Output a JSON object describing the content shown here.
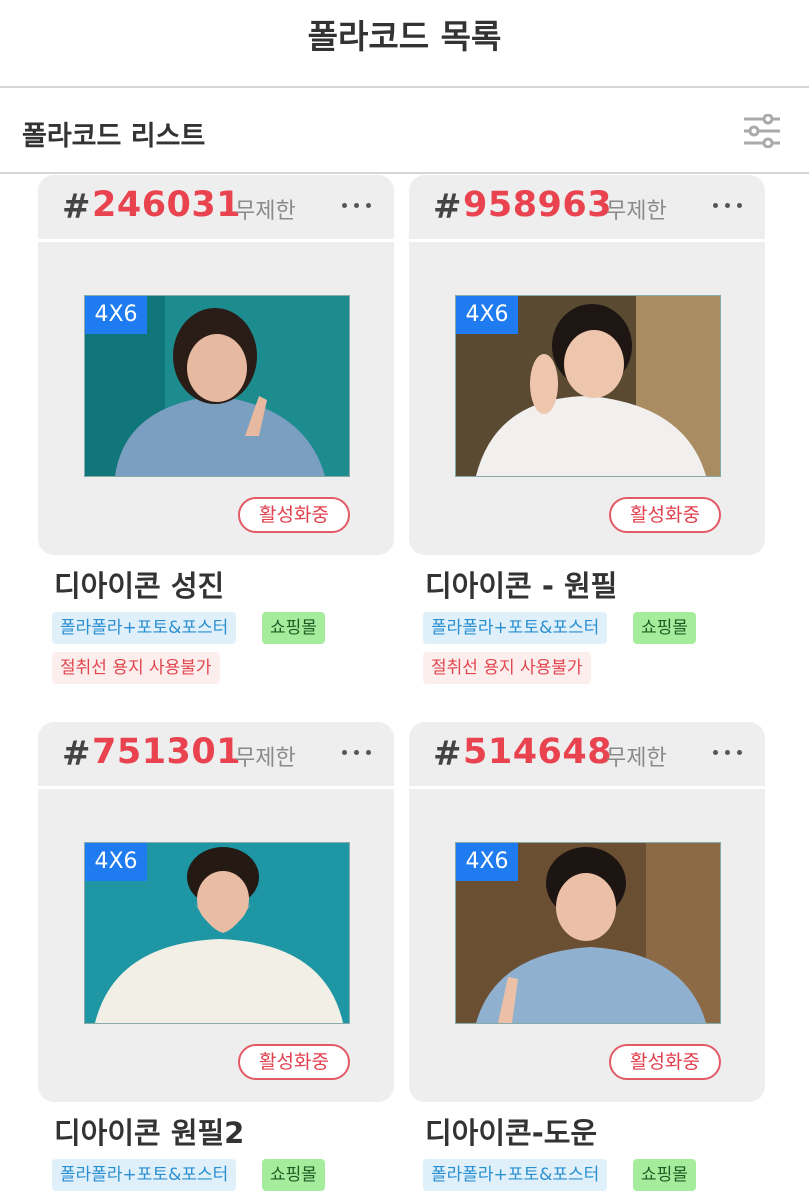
{
  "header": {
    "title": "폴라코드 목록"
  },
  "subheader": {
    "title": "폴라코드 리스트"
  },
  "cards": [
    {
      "hash": "#",
      "code": "246031",
      "limit": "무제한",
      "size": "4X6",
      "status": "활성화중",
      "title": "디아이콘 성진",
      "tags": [
        "폴라폴라+포토&포스터",
        "쇼핑몰"
      ],
      "warning": "절취선 용지 사용불가"
    },
    {
      "hash": "#",
      "code": "958963",
      "limit": "무제한",
      "size": "4X6",
      "status": "활성화중",
      "title": "디아이콘 - 원필",
      "tags": [
        "폴라폴라+포토&포스터",
        "쇼핑몰"
      ],
      "warning": "절취선 용지 사용불가"
    },
    {
      "hash": "#",
      "code": "751301",
      "limit": "무제한",
      "size": "4X6",
      "status": "활성화중",
      "title": "디아이콘 원필2",
      "tags": [
        "폴라폴라+포토&포스터",
        "쇼핑몰"
      ]
    },
    {
      "hash": "#",
      "code": "514648",
      "limit": "무제한",
      "size": "4X6",
      "status": "활성화중",
      "title": "디아이콘-도운",
      "tags": [
        "폴라폴라+포토&포스터",
        "쇼핑몰"
      ]
    }
  ]
}
